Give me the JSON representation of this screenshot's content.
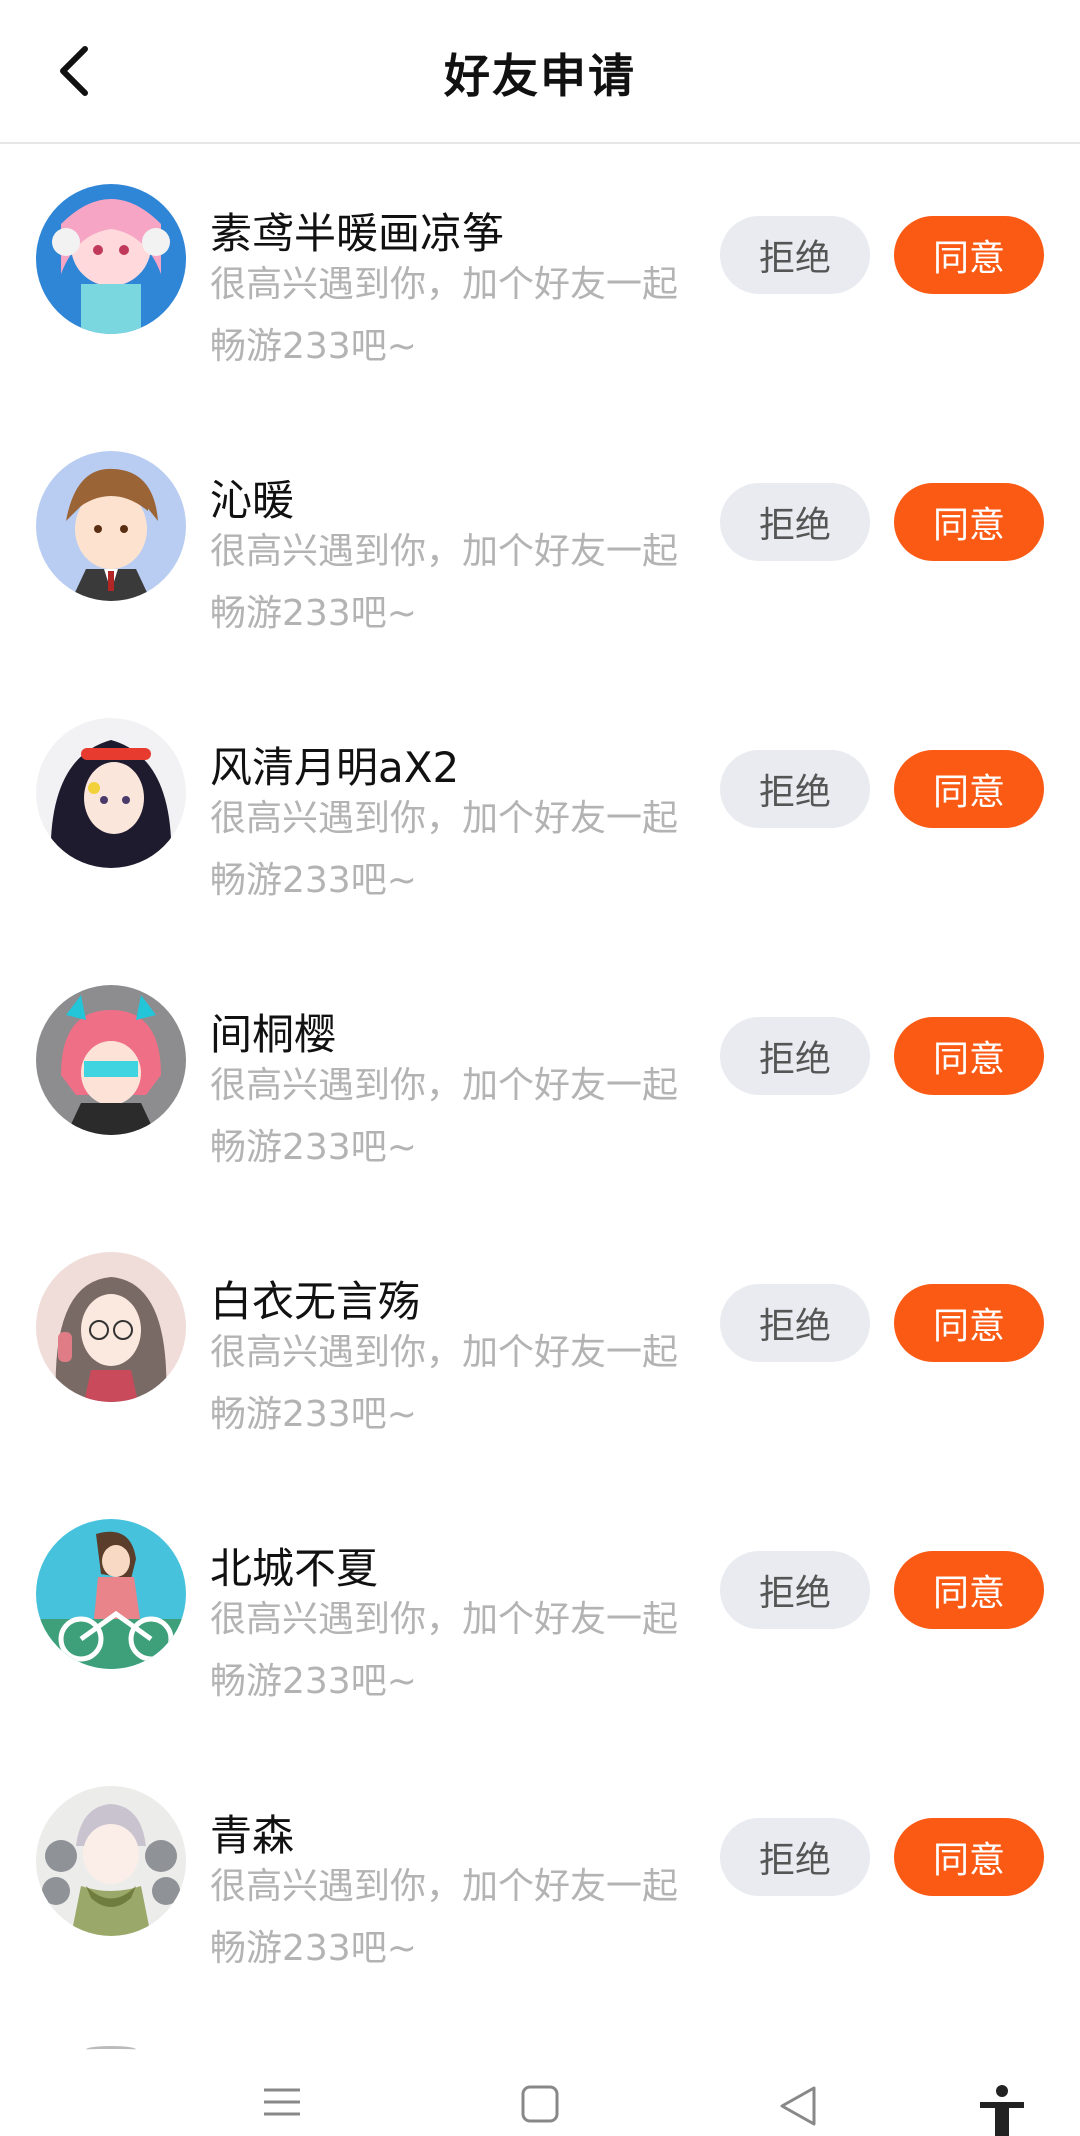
{
  "header": {
    "title": "好友申请",
    "back_icon": "chevron-left-icon"
  },
  "actions": {
    "reject_label": "拒绝",
    "accept_label": "同意",
    "accept_color": "#fb5a14",
    "reject_bg": "#e9ebf0"
  },
  "requests": [
    {
      "name": "素鸢半暖画凉筝",
      "message": "很高兴遇到你，加个好友一起畅游233吧~"
    },
    {
      "name": "沁暖",
      "message": "很高兴遇到你，加个好友一起畅游233吧~"
    },
    {
      "name": "风清月明aX2",
      "message": "很高兴遇到你，加个好友一起畅游233吧~"
    },
    {
      "name": "间桐樱",
      "message": "很高兴遇到你，加个好友一起畅游233吧~"
    },
    {
      "name": "白衣无言殇",
      "message": "很高兴遇到你，加个好友一起畅游233吧~"
    },
    {
      "name": "北城不夏",
      "message": "很高兴遇到你，加个好友一起畅游233吧~"
    },
    {
      "name": "青森",
      "message": "很高兴遇到你，加个好友一起畅游233吧~"
    }
  ],
  "navbar": {
    "items": [
      "menu-icon",
      "home-square-icon",
      "back-triangle-icon",
      "accessibility-icon"
    ]
  }
}
